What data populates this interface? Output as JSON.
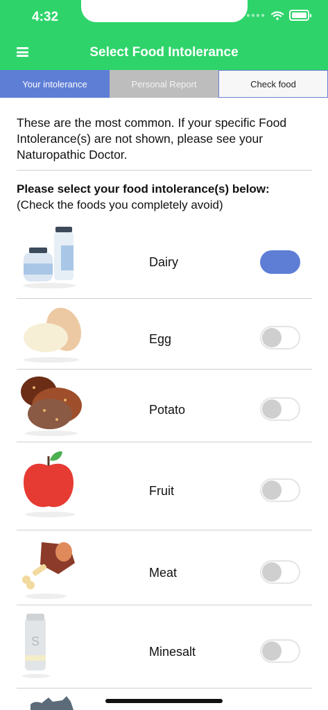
{
  "status": {
    "time": "4:32"
  },
  "header": {
    "title": "Select Food Intolerance"
  },
  "tabs": [
    {
      "label": "Your intolerance"
    },
    {
      "label": "Personal Report"
    },
    {
      "label": "Check food"
    }
  ],
  "intro": {
    "text": "These are the most common. If your specific Food Intolerance(s) are not shown, please see your Naturopathic Doctor."
  },
  "prompt": {
    "heading": "Please select your food intolerance(s) below:",
    "subtext": "(Check the foods you completely avoid)"
  },
  "foods": [
    {
      "label": "Dairy",
      "icon": "dairy-icon",
      "selected": true
    },
    {
      "label": "Egg",
      "icon": "egg-icon",
      "selected": false
    },
    {
      "label": "Potato",
      "icon": "potato-icon",
      "selected": false
    },
    {
      "label": "Fruit",
      "icon": "apple-icon",
      "selected": false
    },
    {
      "label": "Meat",
      "icon": "meat-icon",
      "selected": false
    },
    {
      "label": "Minesalt",
      "icon": "salt-shaker-icon",
      "selected": false
    }
  ],
  "colors": {
    "accent": "#5e7ed6",
    "header": "#2ed46a",
    "toggle_off": "#cfcfcf"
  }
}
